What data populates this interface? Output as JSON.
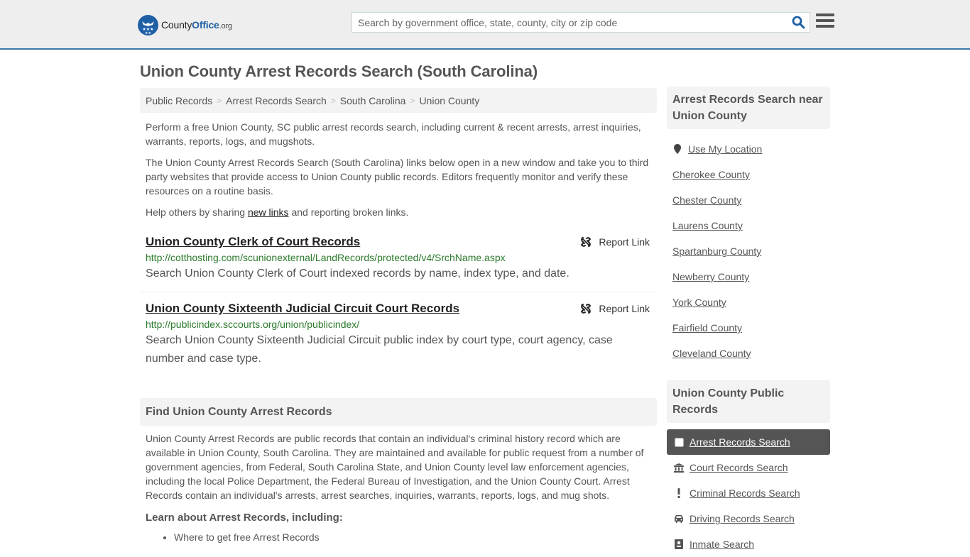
{
  "header": {
    "logo": {
      "name_part1": "County",
      "name_part2": "Office",
      "tld": ".org"
    },
    "search": {
      "placeholder": "Search by government office, state, county, city or zip code",
      "value": ""
    },
    "colors": {
      "brand": "#1e5fa6",
      "accent_border": "#3a78aa"
    }
  },
  "page": {
    "title": "Union County Arrest Records Search (South Carolina)"
  },
  "breadcrumb": [
    {
      "label": "Public Records"
    },
    {
      "label": "Arrest Records Search"
    },
    {
      "label": "South Carolina"
    },
    {
      "label": "Union County"
    }
  ],
  "intro": {
    "p1": "Perform a free Union County, SC public arrest records search, including current & recent arrests, arrest inquiries, warrants, reports, logs, and mugshots.",
    "p2": "The Union County Arrest Records Search (South Carolina) links below open in a new window and take you to third party websites that provide access to Union County public records. Editors frequently monitor and verify these resources on a routine basis.",
    "p3_before": "Help others by sharing ",
    "p3_link": "new links",
    "p3_after": " and reporting broken links."
  },
  "records": [
    {
      "title": "Union County Clerk of Court Records",
      "url": "http://cotthosting.com/scunionexternal/LandRecords/protected/v4/SrchName.aspx",
      "description": "Search Union County Clerk of Court indexed records by name, index type, and date.",
      "report_label": "Report Link"
    },
    {
      "title": "Union County Sixteenth Judicial Circuit Court Records",
      "url": "http://publicindex.sccourts.org/union/publicindex/",
      "description": "Search Union County Sixteenth Judicial Circuit public index by court type, court agency, case number and case type.",
      "report_label": "Report Link"
    }
  ],
  "find_section": {
    "heading": "Find Union County Arrest Records",
    "body": "Union County Arrest Records are public records that contain an individual's criminal history record which are available in Union County, South Carolina. They are maintained and available for public request from a number of government agencies, from Federal, South Carolina State, and Union County level law enforcement agencies, including the local Police Department, the Federal Bureau of Investigation, and the Union County Court. Arrest Records contain an individual's arrests, arrest searches, inquiries, warrants, reports, logs, and mug shots.",
    "learn_heading": "Learn about Arrest Records, including:",
    "learn_items": [
      "Where to get free Arrest Records"
    ]
  },
  "sidebar": {
    "near_heading": "Arrest Records Search near Union County",
    "use_location": "Use My Location",
    "near_items": [
      "Cherokee County",
      "Chester County",
      "Laurens County",
      "Spartanburg County",
      "Newberry County",
      "York County",
      "Fairfield County",
      "Cleveland County"
    ],
    "public_records_heading": "Union County Public Records",
    "public_records": [
      {
        "label": "Arrest Records Search",
        "icon": "square-icon",
        "active": true
      },
      {
        "label": "Court Records Search",
        "icon": "courthouse-icon",
        "active": false
      },
      {
        "label": "Criminal Records Search",
        "icon": "exclamation-icon",
        "active": false
      },
      {
        "label": "Driving Records Search",
        "icon": "car-icon",
        "active": false
      },
      {
        "label": "Inmate Search",
        "icon": "inmate-icon",
        "active": false
      }
    ]
  }
}
